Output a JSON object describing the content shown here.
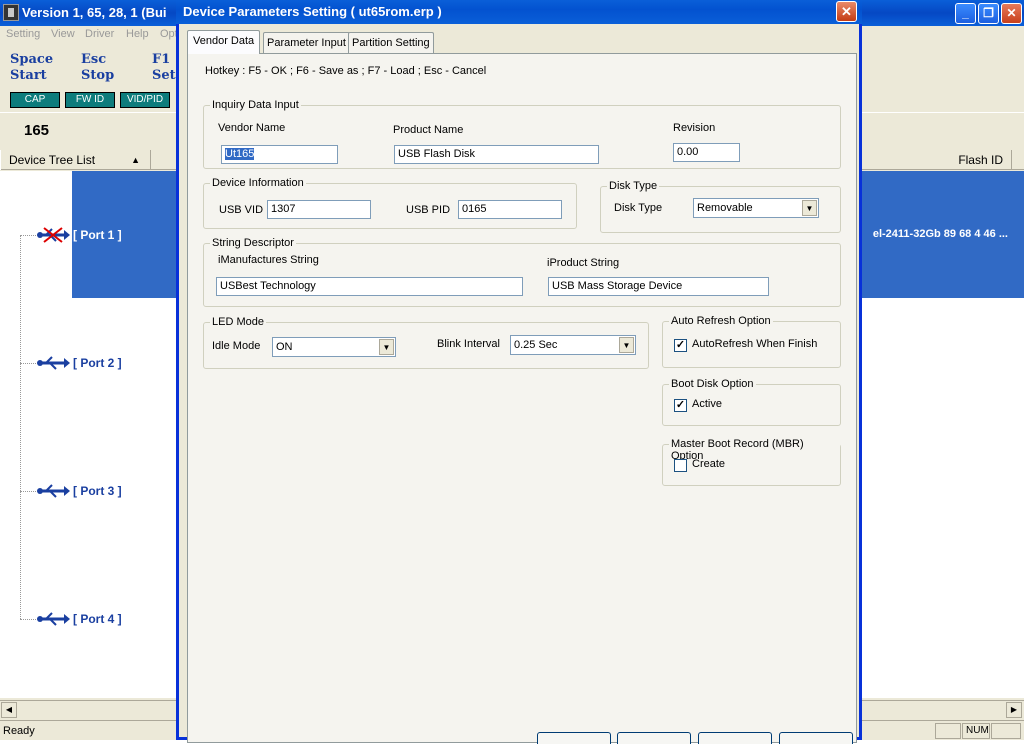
{
  "background_window": {
    "title": "Version 1, 65, 28, 1 (Bui",
    "menu": [
      "Setting",
      "View",
      "Driver",
      "Help",
      "Opt"
    ],
    "hotkeys": [
      {
        "key": "Space",
        "action": "Start"
      },
      {
        "key": "Esc",
        "action": "Stop"
      },
      {
        "key": "F1",
        "action": "Sett"
      }
    ],
    "buttons": [
      "CAP",
      "FW ID",
      "VID/PID"
    ],
    "count": "165",
    "columns": {
      "tree": "Device Tree List",
      "flash": "Flash ID"
    },
    "ports": [
      "[ Port  1 ]",
      "[ Port  2 ]",
      "[ Port  3 ]",
      "[ Port  4 ]"
    ],
    "selected_flash_id": "el-2411-32Gb 89 68 4 46 ...",
    "status": {
      "text": "Ready",
      "num": "NUM"
    }
  },
  "dialog": {
    "title": "Device Parameters Setting ( ut65rom.erp )",
    "tabs": [
      "Vendor Data",
      "Parameter Input",
      "Partition Setting"
    ],
    "hotkey_text": "Hotkey : F5 - OK ; F6 - Save as ; F7 - Load ; Esc - Cancel",
    "inquiry": {
      "caption": "Inquiry Data Input",
      "vendor_label": "Vendor Name",
      "vendor_value": "Ut165",
      "product_label": "Product Name",
      "product_value": "USB Flash Disk",
      "revision_label": "Revision",
      "revision_value": "0.00"
    },
    "device_info": {
      "caption": "Device Information",
      "vid_label": "USB VID",
      "vid_value": "1307",
      "pid_label": "USB PID",
      "pid_value": "0165"
    },
    "disk_type": {
      "caption": "Disk Type",
      "label": "Disk Type",
      "value": "Removable"
    },
    "string_descriptor": {
      "caption": "String Descriptor",
      "manu_label": "iManufactures String",
      "manu_value": "USBest Technology",
      "product_label": "iProduct String",
      "product_value": "USB Mass Storage Device"
    },
    "led": {
      "caption": "LED Mode",
      "idle_label": "Idle Mode",
      "idle_value": "ON",
      "blink_label": "Blink Interval",
      "blink_value": "0.25 Sec"
    },
    "auto_refresh": {
      "caption": "Auto Refresh Option",
      "label": "AutoRefresh When Finish",
      "checked": true
    },
    "boot_disk": {
      "caption": "Boot Disk Option",
      "label": "Active",
      "checked": true
    },
    "mbr": {
      "caption": "Master Boot Record (MBR) Option",
      "label": "Create",
      "checked": false
    }
  }
}
